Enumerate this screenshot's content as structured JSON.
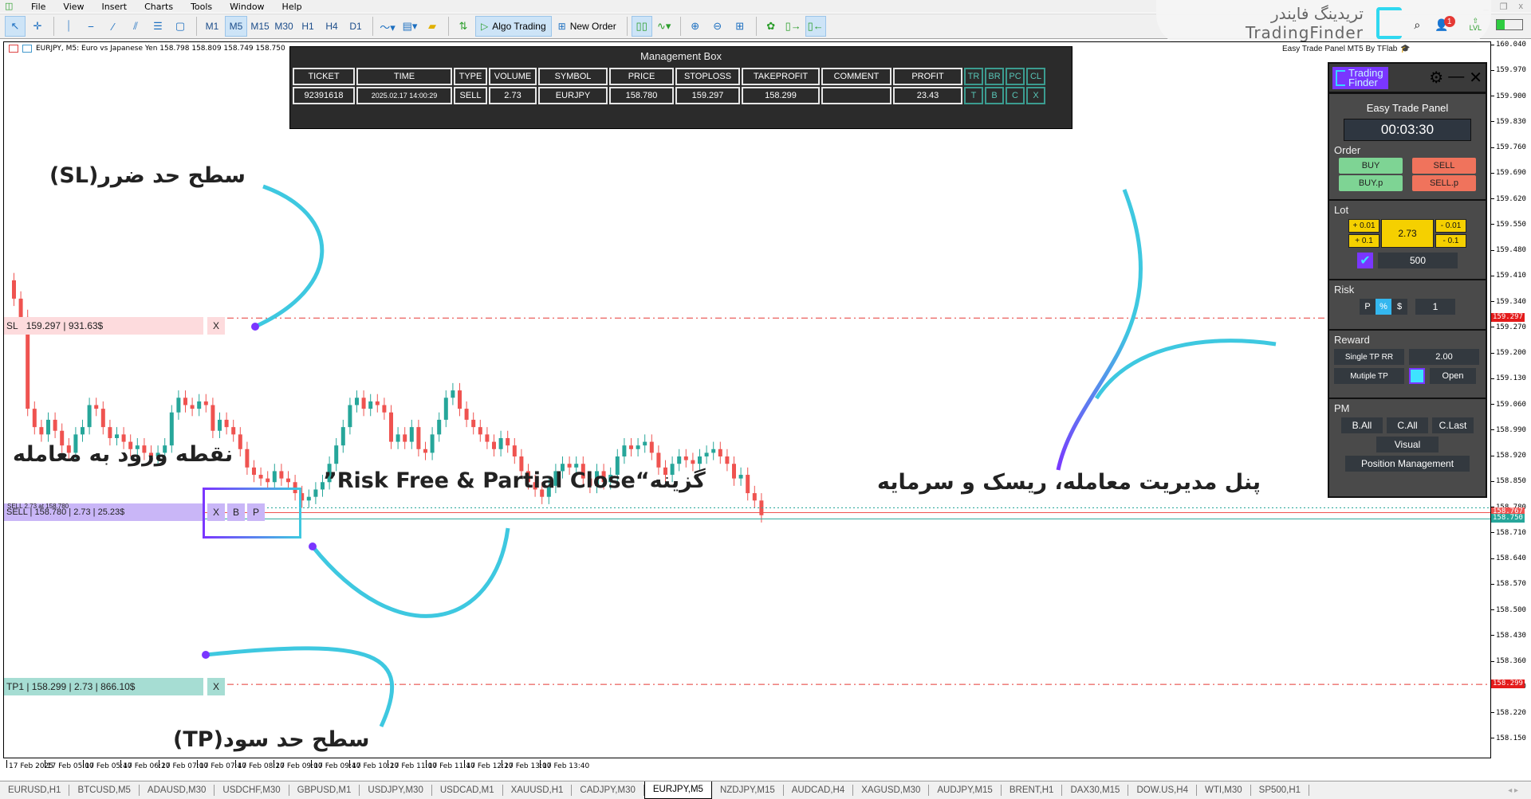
{
  "menu": [
    "File",
    "View",
    "Insert",
    "Charts",
    "Tools",
    "Window",
    "Help"
  ],
  "toolbar": {
    "timeframes": [
      "M1",
      "M5",
      "M15",
      "M30",
      "H1",
      "H4",
      "D1"
    ],
    "active_timeframe": "M5",
    "algo_trading_label": "Algo Trading",
    "new_order_label": "New Order"
  },
  "branding": {
    "fa_name": "تریدینگ فایندر",
    "en_name": "TradingFinder"
  },
  "notifications": {
    "count": "1"
  },
  "lvl_label": "LVL",
  "chart": {
    "title": "EURJPY, M5:  Euro vs Japanese Yen  158.798 158.809 158.749 158.750",
    "credit": "Easy Trade Panel MT5 By TFlab",
    "price_ticks": [
      "160.040",
      "159.970",
      "159.900",
      "159.830",
      "159.760",
      "159.690",
      "159.620",
      "159.550",
      "159.480",
      "159.410",
      "159.340",
      "159.270",
      "159.200",
      "159.130",
      "159.060",
      "158.990",
      "158.920",
      "158.850",
      "158.780",
      "158.710",
      "158.640",
      "158.570",
      "158.500",
      "158.430",
      "158.360",
      "158.290",
      "158.220",
      "158.150"
    ],
    "sl_tag": "159.297",
    "ask_tag": "158.767",
    "bid_tag": "158.750",
    "tp_tag": "158.299",
    "time_ticks": [
      "17 Feb 2025",
      "17 Feb 05:00",
      "17 Feb 05:40",
      "17 Feb 06:20",
      "17 Feb 07:00",
      "17 Feb 07:40",
      "17 Feb 08:20",
      "17 Feb 09:00",
      "17 Feb 09:40",
      "17 Feb 10:20",
      "17 Feb 11:00",
      "17 Feb 11:40",
      "17 Feb 12:20",
      "17 Feb 13:00",
      "17 Feb 13:40"
    ],
    "colors": {
      "bull": "#26a69a",
      "bear": "#ef5350",
      "sl_line": "#e53935"
    }
  },
  "lines": {
    "sl_label": "SL",
    "sl_text": "159.297 | 931.63$",
    "sell_label": "SELL | 158.780 | 2.73 | 25.23$",
    "sell_small": "SELL 2.73 at 158.780",
    "tp_label": "TP1 | 158.299 | 2.73 | 866.10$",
    "x": "X",
    "b": "B",
    "p": "P"
  },
  "management_box": {
    "title": "Management Box",
    "headers": [
      "TICKET",
      "TIME",
      "TYPE",
      "VOLUME",
      "SYMBOL",
      "PRICE",
      "STOPLOSS",
      "TAKEPROFIT",
      "COMMENT",
      "PROFIT",
      "TR",
      "BR",
      "PC",
      "CL"
    ],
    "row": [
      "92391618",
      "2025.02.17 14:00:29",
      "SELL",
      "2.73",
      "EURJPY",
      "158.780",
      "159.297",
      "158.299",
      "",
      "23.43",
      "T",
      "B",
      "C",
      "X"
    ]
  },
  "panel": {
    "logo_line1": "Trading",
    "logo_line2": "Finder",
    "title": "Easy Trade Panel",
    "timer": "00:03:30",
    "order_label": "Order",
    "buy": "BUY",
    "sell": "SELL",
    "buy_p": "BUY.p",
    "sell_p": "SELL.p",
    "lot_label": "Lot",
    "lot_plus_001": "+ 0.01",
    "lot_plus_01": "+ 0.1",
    "lot_value": "2.73",
    "lot_minus_001": "- 0.01",
    "lot_minus_01": "- 0.1",
    "lot_points": "500",
    "risk_label": "Risk",
    "risk_modes": [
      "P",
      "%",
      "$"
    ],
    "risk_mode_selected": "%",
    "risk_value": "1",
    "reward_label": "Reward",
    "single_tp": "Single TP RR",
    "rr_value": "2.00",
    "multiple_tp": "Mutiple TP",
    "open": "Open",
    "pm_label": "PM",
    "b_all": "B.All",
    "c_all": "C.All",
    "c_last": "C.Last",
    "visual": "Visual",
    "position_mgmt": "Position Management"
  },
  "annotations": {
    "sl": "سطح حد ضرر(SL)",
    "entry": "نقطه ورود به معامله",
    "risk_free": "گزینه“Risk Free & Partial Close”",
    "panel": "پنل مدیریت معامله، ریسک و سرمایه",
    "tp": "سطح حد سود(TP)"
  },
  "symbol_tabs": [
    "EURUSD,H1",
    "BTCUSD,M5",
    "ADAUSD,M30",
    "USDCHF,M30",
    "GBPUSD,M1",
    "USDJPY,M30",
    "USDCAD,M1",
    "XAUUSD,H1",
    "CADJPY,M30",
    "EURJPY,M5",
    "NZDJPY,M15",
    "AUDCAD,H4",
    "XAGUSD,M30",
    "AUDJPY,M15",
    "BRENT,H1",
    "DAX30,M15",
    "DOW.US,H4",
    "WTI,M30",
    "SP500,H1"
  ],
  "active_symbol_tab": "EURJPY,M5"
}
